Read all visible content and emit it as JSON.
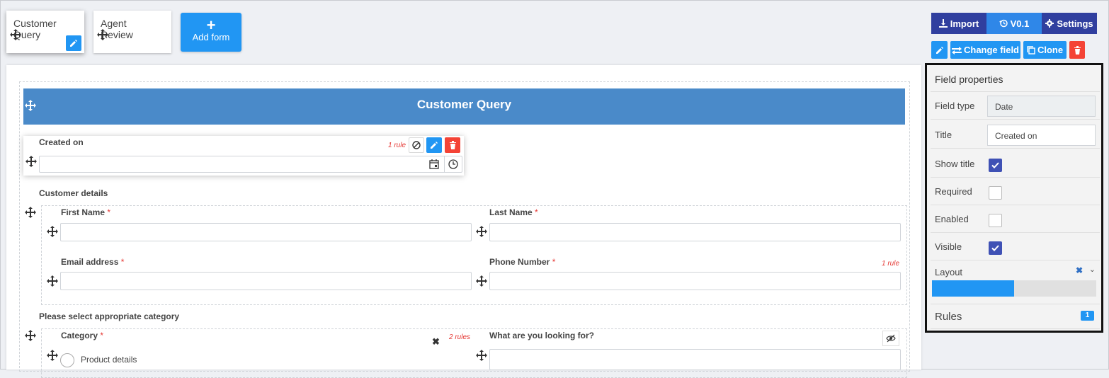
{
  "tabs": [
    {
      "label": "Customer Query",
      "active": true
    },
    {
      "label": "Agent Review",
      "active": false
    }
  ],
  "add_form_label": "Add form",
  "toolbar": {
    "import_label": "Import",
    "version_label": "V0.1",
    "settings_label": "Settings",
    "change_field_label": "Change field",
    "clone_label": "Clone"
  },
  "form": {
    "title": "Customer Query",
    "created_on": {
      "label": "Created on",
      "rule_count": "1 rule"
    },
    "customer_details": {
      "section_label": "Customer details"
    },
    "first_name": {
      "label": "First Name",
      "required": "*"
    },
    "last_name": {
      "label": "Last Name",
      "required": "*"
    },
    "email": {
      "label": "Email address",
      "required": "*"
    },
    "phone": {
      "label": "Phone Number",
      "required": "*",
      "rule_count": "1 rule"
    },
    "category_section": {
      "section_label": "Please select appropriate category"
    },
    "category": {
      "label": "Category",
      "required": "*",
      "rule_count": "2 rules",
      "option_1": "Product details"
    },
    "looking_for": {
      "label": "What are you looking for?"
    }
  },
  "properties": {
    "heading": "Field properties",
    "field_type": {
      "label": "Field type",
      "value": "Date"
    },
    "title": {
      "label": "Title",
      "value": "Created on"
    },
    "show_title": {
      "label": "Show title",
      "checked": true
    },
    "required": {
      "label": "Required",
      "checked": false
    },
    "enabled": {
      "label": "Enabled",
      "checked": false
    },
    "visible": {
      "label": "Visible",
      "checked": true
    },
    "layout": {
      "label": "Layout",
      "fill_fraction": 0.5
    },
    "rules": {
      "label": "Rules",
      "count": "1"
    }
  },
  "colors": {
    "primary": "#2196f3",
    "toolbar_dark": "#303f9f",
    "header_bar": "#4a8ac9",
    "danger": "#f44336"
  }
}
